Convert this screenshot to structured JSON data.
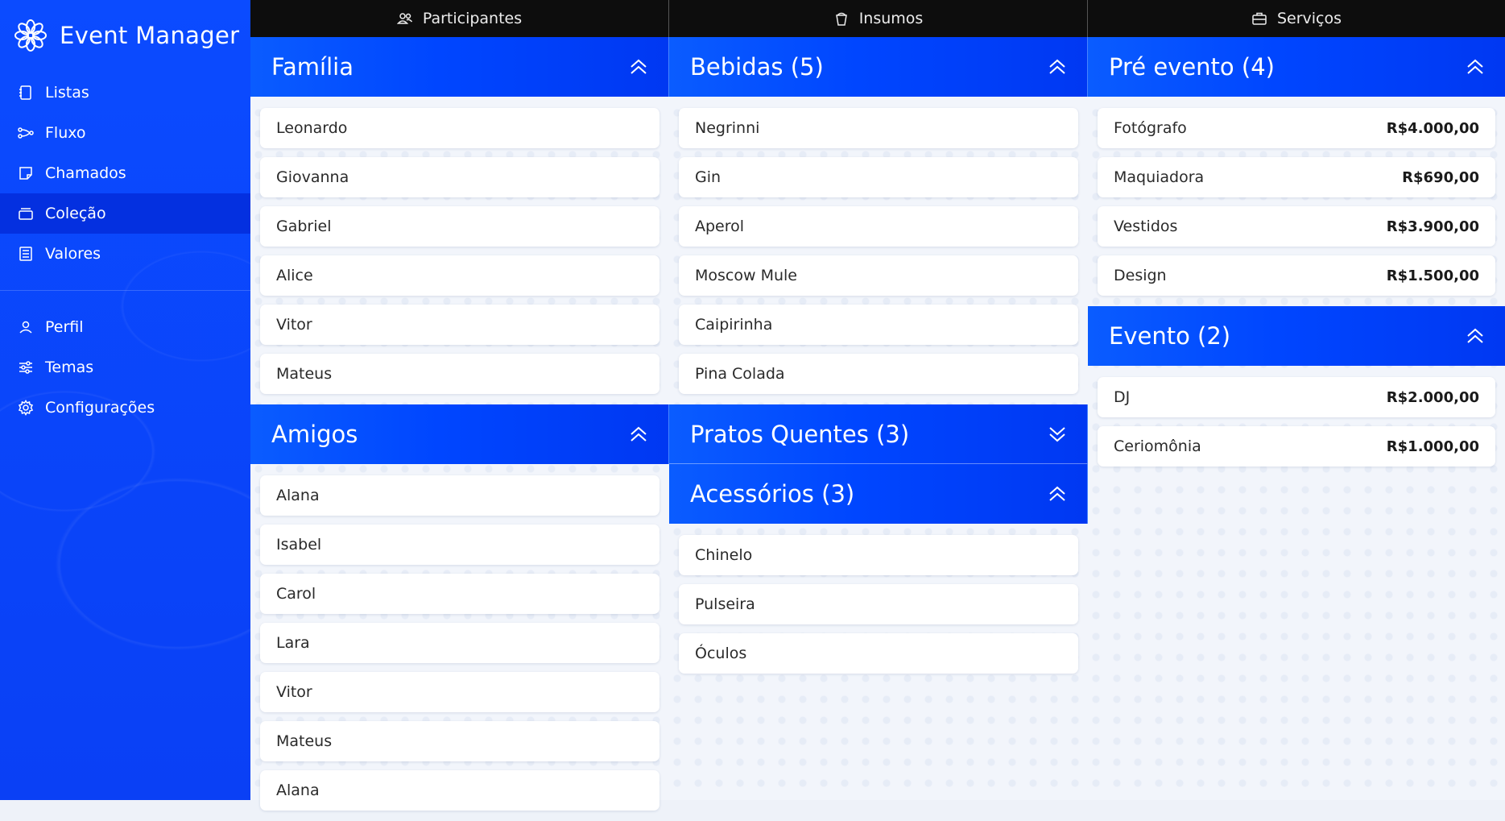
{
  "sidebar": {
    "brand": "Event Manager",
    "nav": [
      {
        "label": "Listas",
        "icon": "notebook-icon"
      },
      {
        "label": "Fluxo",
        "icon": "flow-icon"
      },
      {
        "label": "Chamados",
        "icon": "note-icon"
      },
      {
        "label": "Coleção",
        "icon": "collection-icon",
        "active": true
      },
      {
        "label": "Valores",
        "icon": "ledger-icon"
      }
    ],
    "nav2": [
      {
        "label": "Perfil",
        "icon": "user-icon"
      },
      {
        "label": "Temas",
        "icon": "sliders-icon"
      },
      {
        "label": "Configurações",
        "icon": "gear-icon"
      }
    ]
  },
  "tabs": [
    {
      "label": "Participantes",
      "icon": "people-icon"
    },
    {
      "label": "Insumos",
      "icon": "cup-icon"
    },
    {
      "label": "Serviços",
      "icon": "briefcase-icon"
    }
  ],
  "columns": {
    "participantes": {
      "familia": {
        "title": "Família",
        "items": [
          "Leonardo",
          "Giovanna",
          "Gabriel",
          "Alice",
          "Vitor",
          "Mateus"
        ]
      },
      "amigos": {
        "title": "Amigos",
        "items": [
          "Alana",
          "Isabel",
          "Carol",
          "Lara",
          "Vitor",
          "Mateus",
          "Alana"
        ]
      }
    },
    "insumos": {
      "bebidas": {
        "title": "Bebidas (5)",
        "items": [
          "Negrinni",
          "Gin",
          "Aperol",
          "Moscow Mule",
          "Caipirinha",
          "Pina Colada"
        ]
      },
      "pratos": {
        "title": "Pratos Quentes (3)"
      },
      "acessorios": {
        "title": "Acessórios (3)",
        "items": [
          "Chinelo",
          "Pulseira",
          "Óculos"
        ]
      }
    },
    "servicos": {
      "pre": {
        "title": "Pré evento (4)",
        "items": [
          {
            "name": "Fotógrafo",
            "price": "R$4.000,00"
          },
          {
            "name": "Maquiadora",
            "price": "R$690,00"
          },
          {
            "name": "Vestidos",
            "price": "R$3.900,00"
          },
          {
            "name": "Design",
            "price": "R$1.500,00"
          }
        ]
      },
      "evento": {
        "title": "Evento (2)",
        "items": [
          {
            "name": "DJ",
            "price": "R$2.000,00"
          },
          {
            "name": "Ceriomônia",
            "price": "R$1.000,00"
          }
        ]
      }
    }
  }
}
